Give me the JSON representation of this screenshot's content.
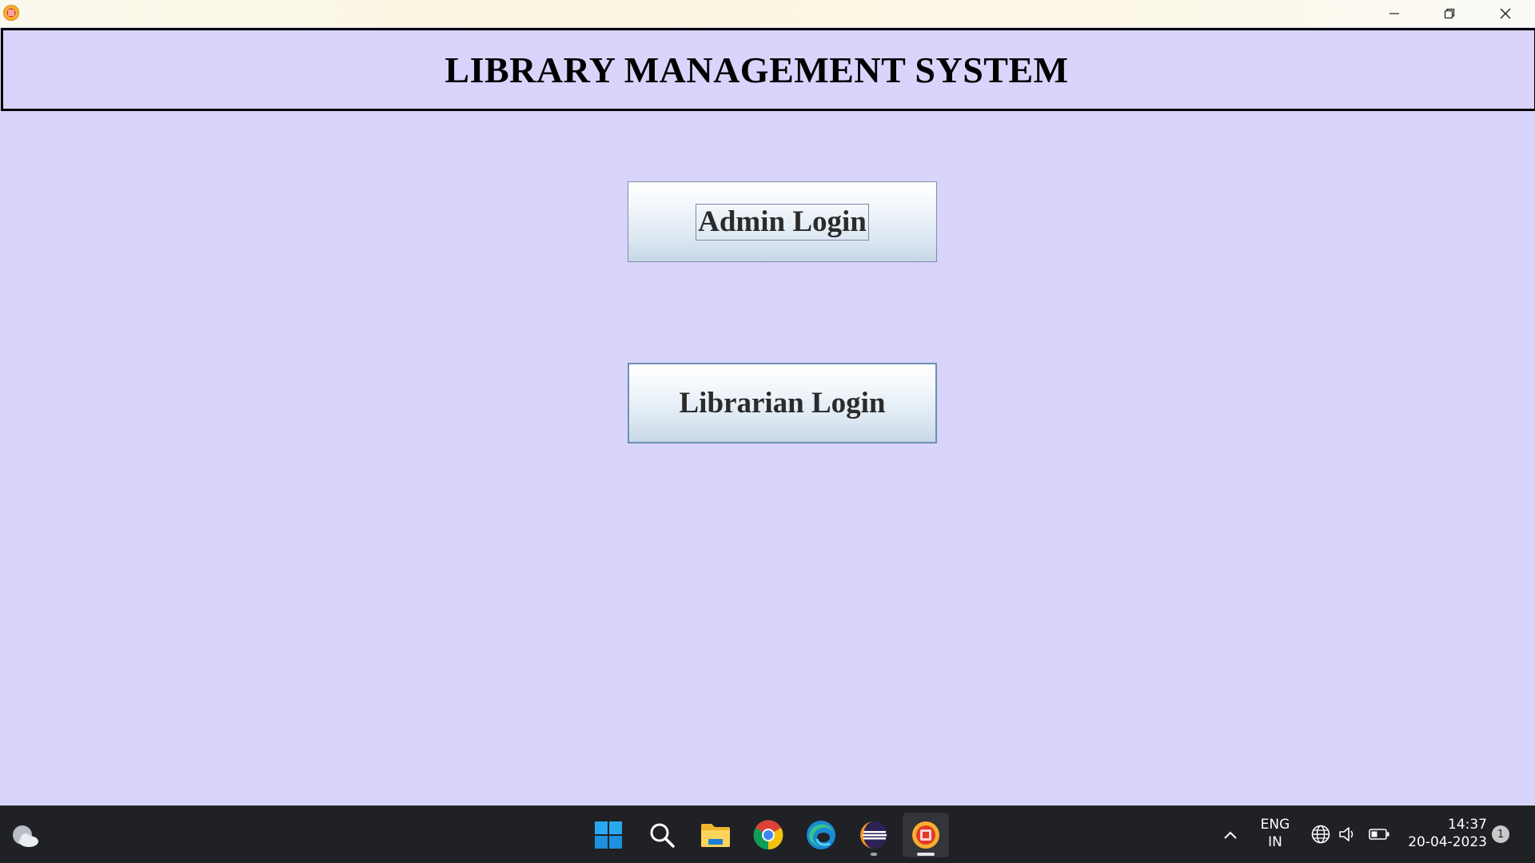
{
  "window": {
    "app_icon": "library-app-icon",
    "controls": {
      "minimize_icon": "minimize-icon",
      "maximize_icon": "restore-icon",
      "close_icon": "close-icon"
    }
  },
  "header": {
    "title": "LIBRARY MANAGEMENT SYSTEM"
  },
  "main": {
    "admin_login_label": "Admin Login",
    "librarian_login_label": "Librarian Login"
  },
  "colors": {
    "background": "#d8d4fc",
    "taskbar": "#1f2125",
    "button_gradient_top": "#ffffff",
    "button_gradient_bottom": "#c7d7e6"
  },
  "taskbar": {
    "weather_icon": "weather-cloud-icon",
    "apps": [
      {
        "name": "start",
        "icon": "windows-start-icon"
      },
      {
        "name": "search",
        "icon": "search-icon"
      },
      {
        "name": "file-explorer",
        "icon": "folder-icon"
      },
      {
        "name": "chrome",
        "icon": "chrome-icon"
      },
      {
        "name": "edge",
        "icon": "edge-icon"
      },
      {
        "name": "eclipse",
        "icon": "eclipse-icon"
      },
      {
        "name": "library-app",
        "icon": "library-app-icon"
      }
    ],
    "tray": {
      "language_line1": "ENG",
      "language_line2": "IN",
      "time": "14:37",
      "date": "20-04-2023",
      "notification_count": "1"
    }
  }
}
